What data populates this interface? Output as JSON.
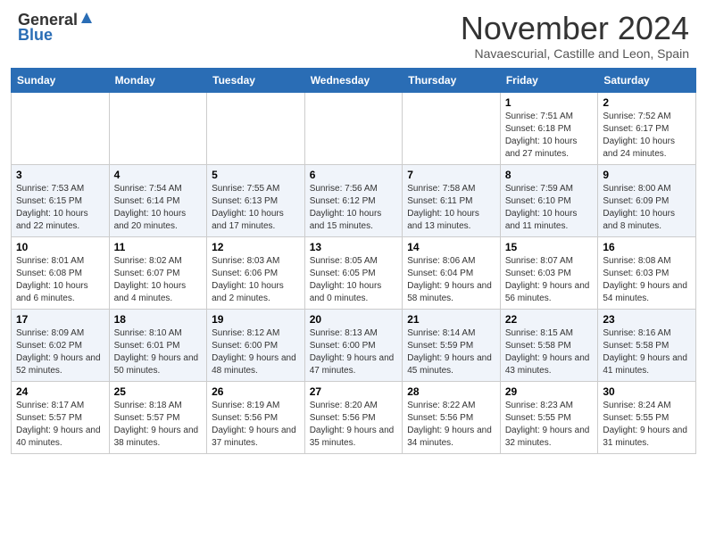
{
  "logo": {
    "general": "General",
    "blue": "Blue"
  },
  "header": {
    "month": "November 2024",
    "location": "Navaescurial, Castille and Leon, Spain"
  },
  "days_of_week": [
    "Sunday",
    "Monday",
    "Tuesday",
    "Wednesday",
    "Thursday",
    "Friday",
    "Saturday"
  ],
  "weeks": [
    [
      {
        "day": "",
        "info": ""
      },
      {
        "day": "",
        "info": ""
      },
      {
        "day": "",
        "info": ""
      },
      {
        "day": "",
        "info": ""
      },
      {
        "day": "",
        "info": ""
      },
      {
        "day": "1",
        "info": "Sunrise: 7:51 AM\nSunset: 6:18 PM\nDaylight: 10 hours and 27 minutes."
      },
      {
        "day": "2",
        "info": "Sunrise: 7:52 AM\nSunset: 6:17 PM\nDaylight: 10 hours and 24 minutes."
      }
    ],
    [
      {
        "day": "3",
        "info": "Sunrise: 7:53 AM\nSunset: 6:15 PM\nDaylight: 10 hours and 22 minutes."
      },
      {
        "day": "4",
        "info": "Sunrise: 7:54 AM\nSunset: 6:14 PM\nDaylight: 10 hours and 20 minutes."
      },
      {
        "day": "5",
        "info": "Sunrise: 7:55 AM\nSunset: 6:13 PM\nDaylight: 10 hours and 17 minutes."
      },
      {
        "day": "6",
        "info": "Sunrise: 7:56 AM\nSunset: 6:12 PM\nDaylight: 10 hours and 15 minutes."
      },
      {
        "day": "7",
        "info": "Sunrise: 7:58 AM\nSunset: 6:11 PM\nDaylight: 10 hours and 13 minutes."
      },
      {
        "day": "8",
        "info": "Sunrise: 7:59 AM\nSunset: 6:10 PM\nDaylight: 10 hours and 11 minutes."
      },
      {
        "day": "9",
        "info": "Sunrise: 8:00 AM\nSunset: 6:09 PM\nDaylight: 10 hours and 8 minutes."
      }
    ],
    [
      {
        "day": "10",
        "info": "Sunrise: 8:01 AM\nSunset: 6:08 PM\nDaylight: 10 hours and 6 minutes."
      },
      {
        "day": "11",
        "info": "Sunrise: 8:02 AM\nSunset: 6:07 PM\nDaylight: 10 hours and 4 minutes."
      },
      {
        "day": "12",
        "info": "Sunrise: 8:03 AM\nSunset: 6:06 PM\nDaylight: 10 hours and 2 minutes."
      },
      {
        "day": "13",
        "info": "Sunrise: 8:05 AM\nSunset: 6:05 PM\nDaylight: 10 hours and 0 minutes."
      },
      {
        "day": "14",
        "info": "Sunrise: 8:06 AM\nSunset: 6:04 PM\nDaylight: 9 hours and 58 minutes."
      },
      {
        "day": "15",
        "info": "Sunrise: 8:07 AM\nSunset: 6:03 PM\nDaylight: 9 hours and 56 minutes."
      },
      {
        "day": "16",
        "info": "Sunrise: 8:08 AM\nSunset: 6:03 PM\nDaylight: 9 hours and 54 minutes."
      }
    ],
    [
      {
        "day": "17",
        "info": "Sunrise: 8:09 AM\nSunset: 6:02 PM\nDaylight: 9 hours and 52 minutes."
      },
      {
        "day": "18",
        "info": "Sunrise: 8:10 AM\nSunset: 6:01 PM\nDaylight: 9 hours and 50 minutes."
      },
      {
        "day": "19",
        "info": "Sunrise: 8:12 AM\nSunset: 6:00 PM\nDaylight: 9 hours and 48 minutes."
      },
      {
        "day": "20",
        "info": "Sunrise: 8:13 AM\nSunset: 6:00 PM\nDaylight: 9 hours and 47 minutes."
      },
      {
        "day": "21",
        "info": "Sunrise: 8:14 AM\nSunset: 5:59 PM\nDaylight: 9 hours and 45 minutes."
      },
      {
        "day": "22",
        "info": "Sunrise: 8:15 AM\nSunset: 5:58 PM\nDaylight: 9 hours and 43 minutes."
      },
      {
        "day": "23",
        "info": "Sunrise: 8:16 AM\nSunset: 5:58 PM\nDaylight: 9 hours and 41 minutes."
      }
    ],
    [
      {
        "day": "24",
        "info": "Sunrise: 8:17 AM\nSunset: 5:57 PM\nDaylight: 9 hours and 40 minutes."
      },
      {
        "day": "25",
        "info": "Sunrise: 8:18 AM\nSunset: 5:57 PM\nDaylight: 9 hours and 38 minutes."
      },
      {
        "day": "26",
        "info": "Sunrise: 8:19 AM\nSunset: 5:56 PM\nDaylight: 9 hours and 37 minutes."
      },
      {
        "day": "27",
        "info": "Sunrise: 8:20 AM\nSunset: 5:56 PM\nDaylight: 9 hours and 35 minutes."
      },
      {
        "day": "28",
        "info": "Sunrise: 8:22 AM\nSunset: 5:56 PM\nDaylight: 9 hours and 34 minutes."
      },
      {
        "day": "29",
        "info": "Sunrise: 8:23 AM\nSunset: 5:55 PM\nDaylight: 9 hours and 32 minutes."
      },
      {
        "day": "30",
        "info": "Sunrise: 8:24 AM\nSunset: 5:55 PM\nDaylight: 9 hours and 31 minutes."
      }
    ]
  ]
}
